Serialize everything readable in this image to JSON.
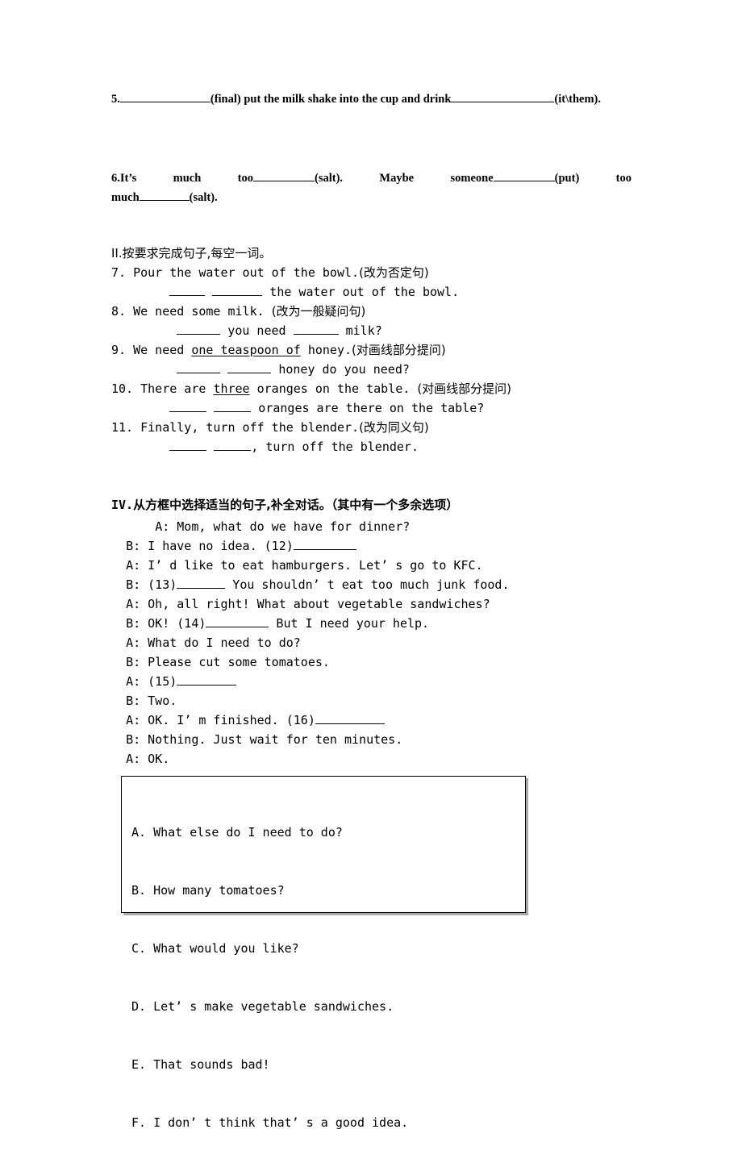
{
  "document": {
    "type": "english-exercise-worksheet",
    "background_color": "#ffffff",
    "text_color": "#000000"
  },
  "fill_in_blanks_serif": {
    "item5": {
      "number": "5.",
      "blank1": "____________",
      "segment1": "(final) put the milk shake into the cup and drink",
      "blank2": "______________",
      "segment2": "(it\\them)."
    },
    "item6": {
      "line1": "6.It’s   much   too",
      "blank1": "__________",
      "segment1": "(salt).   Maybe   someone",
      "blank2": "__________",
      "segment2": "(put)   too",
      "line2_prefix": "much",
      "blank3": "________",
      "line2_suffix": "(salt)."
    }
  },
  "section_ii": {
    "heading": "II.按要求完成句子,每空一词。",
    "items": [
      {
        "number": "7. ",
        "prompt": "Pour the water out of the bowl.",
        "instruction": "(改为否定句)",
        "answer_indent": "        ",
        "answer_blank1": "_____",
        "answer_gap": " ",
        "answer_blank2": "_______",
        "answer_tail": " the water out of the bowl."
      },
      {
        "number": "8. ",
        "prompt": "We need some milk. ",
        "instruction": "(改为一般疑问句)",
        "answer_indent": "         ",
        "answer_blank1": "______",
        "answer_gap": " you need ",
        "answer_blank2": "_______",
        "answer_tail": " milk?"
      },
      {
        "number": "9. ",
        "prompt_pre": "We need ",
        "prompt_underlined": "one teaspoon of",
        "prompt_post": " honey.",
        "instruction": "(对画线部分提问)",
        "answer_indent": "         ",
        "answer_blank1": "______",
        "answer_gap": " ",
        "answer_blank2": "______",
        "answer_tail": " honey do you need?"
      },
      {
        "number": "10. ",
        "prompt_pre": "There are ",
        "prompt_underlined": "three",
        "prompt_post": " oranges on the table. ",
        "instruction": "(对画线部分提问)",
        "answer_indent": "        ",
        "answer_blank1": "_____",
        "answer_gap": " ",
        "answer_blank2": "_____",
        "answer_tail": " oranges are there on the table?"
      },
      {
        "number": "11. ",
        "prompt": "Finally, turn off the blender.",
        "instruction": "(改为同义句)",
        "answer_indent": "        ",
        "answer_blank1": "_____",
        "answer_gap": " ",
        "answer_blank2": "_____",
        "answer_tail": ", turn off the blender."
      }
    ]
  },
  "section_iv": {
    "heading_label": "IV.",
    "heading_text": "从方框中选择适当的句子,补全对话。（其中有一个多余选项）",
    "dialogue": [
      {
        "indent": "      ",
        "speaker": "A: ",
        "text": "Mom, what do we have for dinner?",
        "blank": "",
        "after": ""
      },
      {
        "indent": "  ",
        "speaker": "B: ",
        "text": "I have no idea. (12)",
        "blank": "__________",
        "after": ""
      },
      {
        "indent": "  ",
        "speaker": "A: ",
        "text": "I’ d like to eat hamburgers. Let’ s go to KFC.",
        "blank": "",
        "after": ""
      },
      {
        "indent": "  ",
        "speaker": "B: ",
        "text": "(13)",
        "blank": "_______",
        "after": " You shouldn’ t eat too much junk food."
      },
      {
        "indent": "  ",
        "speaker": "A: ",
        "text": "Oh, all right! What about vegetable sandwiches?",
        "blank": "",
        "after": ""
      },
      {
        "indent": "  ",
        "speaker": "B: ",
        "text": "OK! (14)",
        "blank": "__________",
        "after": " But I need your help."
      },
      {
        "indent": "  ",
        "speaker": "A: ",
        "text": "What do I need to do?",
        "blank": "",
        "after": ""
      },
      {
        "indent": "  ",
        "speaker": "B: ",
        "text": "Please cut some tomatoes.",
        "blank": "",
        "after": ""
      },
      {
        "indent": "  ",
        "speaker": "A: ",
        "text": "(15)",
        "blank": "__________",
        "after": ""
      },
      {
        "indent": "  ",
        "speaker": "B: ",
        "text": "Two.",
        "blank": "",
        "after": ""
      },
      {
        "indent": "  ",
        "speaker": "A: ",
        "text": "OK. I’ m finished. (16)",
        "blank": "___________",
        "after": ""
      },
      {
        "indent": "  ",
        "speaker": "B: ",
        "text": "Nothing. Just wait for ten minutes.",
        "blank": "",
        "after": ""
      },
      {
        "indent": "  ",
        "speaker": "A: ",
        "text": "OK.",
        "blank": "",
        "after": ""
      }
    ],
    "options_box": {
      "border_color": "#000000",
      "shadow_color": "#a9a9a9",
      "options": [
        "A. What else do I need to do?",
        "B. How many tomatoes?",
        "C. What would you like?",
        "D. Let’ s make vegetable sandwiches.",
        "E. That sounds bad!",
        "F. I don’ t think that’ s a good idea."
      ]
    }
  }
}
